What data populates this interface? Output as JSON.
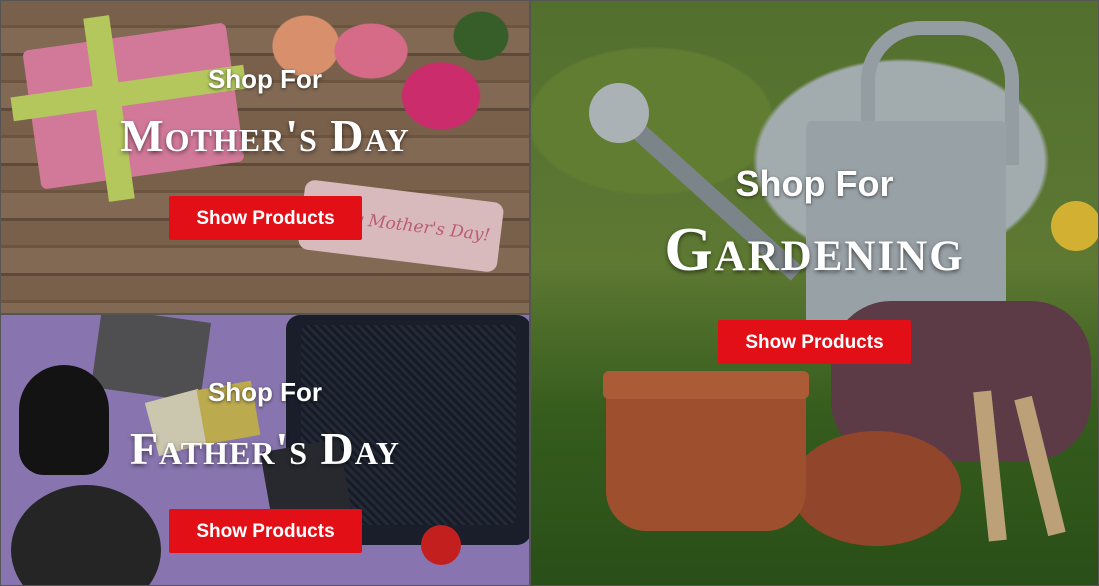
{
  "tiles": {
    "mothers": {
      "shop_for": "Shop For",
      "title": "Mother's Day",
      "button": "Show Products",
      "tag_text": "y Mother's Day!"
    },
    "fathers": {
      "shop_for": "Shop For",
      "title": "Father's Day",
      "button": "Show Products"
    },
    "gardening": {
      "shop_for": "Shop For",
      "title": "Gardening",
      "button": "Show Products"
    }
  },
  "colors": {
    "button_bg": "#e30f17",
    "button_text": "#ffffff",
    "caption_text": "#ffffff"
  }
}
